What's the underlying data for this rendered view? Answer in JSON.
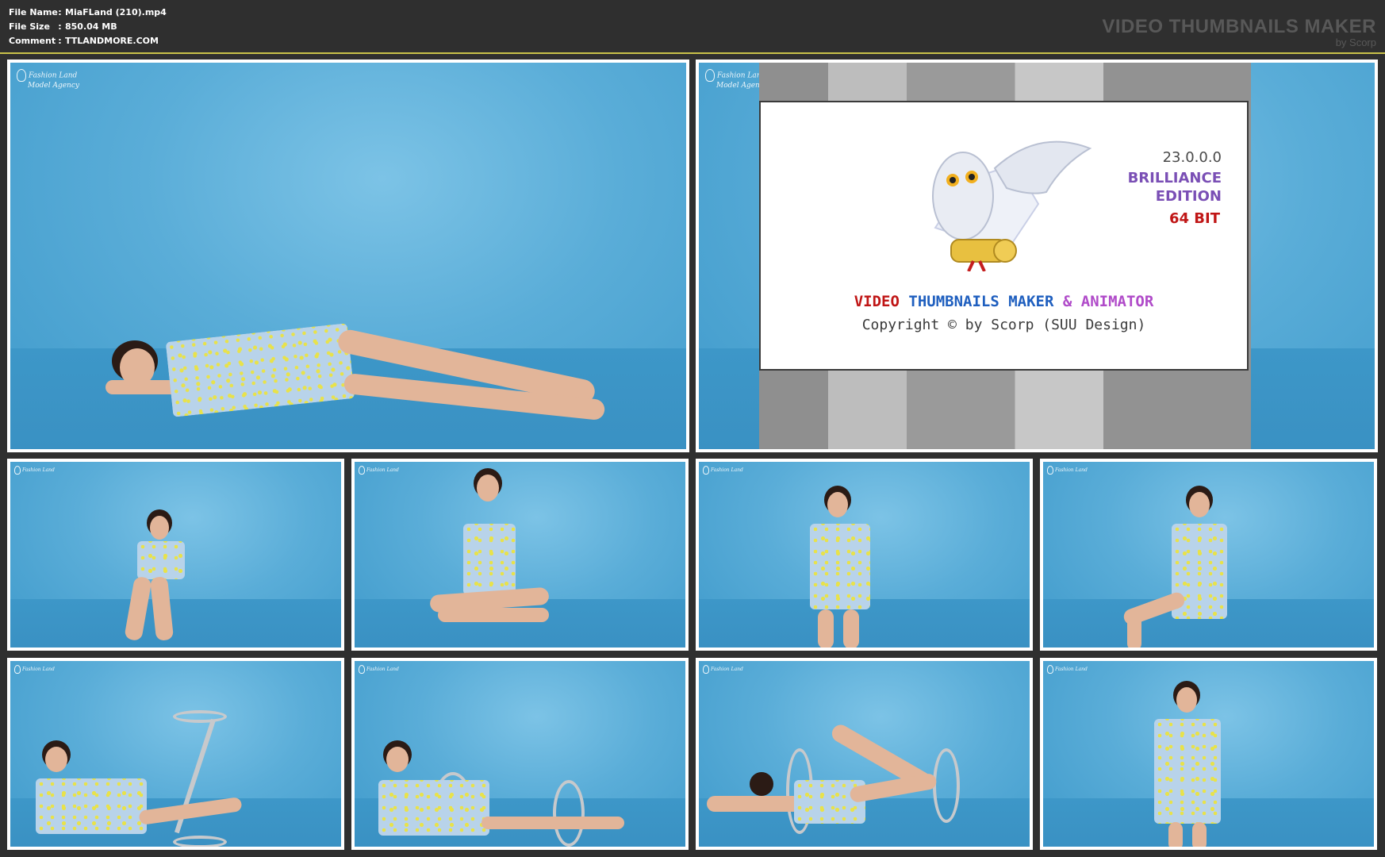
{
  "file_info": {
    "name_key": "File Name",
    "name_value": "MiaFLand (210).mp4",
    "size_key": "File Size",
    "size_value": "850.04 MB",
    "comment_key": "Comment",
    "comment_value": "TTLANDMORE.COM",
    "separator": ":"
  },
  "brand": {
    "title": "VIDEO THUMBNAILS MAKER",
    "subtitle": "by Scorp"
  },
  "watermark": {
    "line1": "Fashion Land",
    "line2": "Model Agency"
  },
  "splash": {
    "version": "23.0.0.0",
    "edition_line1": "BRILLIANCE",
    "edition_line2": "EDITION",
    "bits": "64 BIT",
    "product_word1": "VIDEO",
    "product_word2": "THUMBNAILS MAKER",
    "product_word3": "& ANIMATOR",
    "copyright": "Copyright © by Scorp (SUU Design)"
  },
  "colors": {
    "background": "#2f2f2f",
    "divider": "#c9c24a",
    "frame_border": "#ffffff",
    "backdrop": "#5aadd8"
  },
  "thumbnails": [
    {
      "id": 1,
      "desc": "lying-pose"
    },
    {
      "id": 2,
      "desc": "splash-screen"
    },
    {
      "id": 3,
      "desc": "seated-floor"
    },
    {
      "id": 4,
      "desc": "kneeling-sit"
    },
    {
      "id": 5,
      "desc": "leaning-stool"
    },
    {
      "id": 6,
      "desc": "sitting-stool"
    },
    {
      "id": 7,
      "desc": "reclining-stool"
    },
    {
      "id": 8,
      "desc": "reclining-stool-2"
    },
    {
      "id": 9,
      "desc": "lying-stool"
    },
    {
      "id": 10,
      "desc": "standing"
    }
  ]
}
